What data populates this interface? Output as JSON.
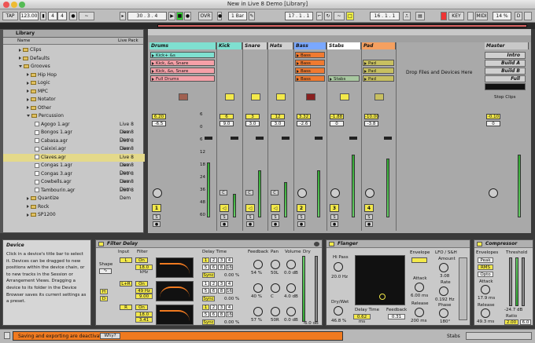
{
  "window": {
    "title": "New in Live 8 Demo  [Library]"
  },
  "toolbar": {
    "tap": "TAP",
    "tempo": "123.00",
    "sig_num": "4",
    "sig_den": "4",
    "pos": "30 .  3 .  4",
    "ovr": "OVR",
    "quant": "1 Bar",
    "loop_start": "17 .  1 .  1",
    "loop_len": "16 .  1 .  1",
    "key": "KEY",
    "midi": "MIDI",
    "cpu": "14 %",
    "d": "D"
  },
  "browser": {
    "title": "Library",
    "col_name": "Name",
    "col_pack": "Live Pack",
    "items": [
      {
        "label": "Clips",
        "type": "folder",
        "level": 0,
        "pack": ""
      },
      {
        "label": "Defaults",
        "type": "folder",
        "level": 0,
        "pack": ""
      },
      {
        "label": "Grooves",
        "type": "folder-open",
        "level": 0,
        "pack": ""
      },
      {
        "label": "Hip Hop",
        "type": "folder",
        "level": 1,
        "pack": ""
      },
      {
        "label": "Logic",
        "type": "folder",
        "level": 1,
        "pack": ""
      },
      {
        "label": "MPC",
        "type": "folder",
        "level": 1,
        "pack": ""
      },
      {
        "label": "Notator",
        "type": "folder",
        "level": 1,
        "pack": ""
      },
      {
        "label": "Other",
        "type": "folder",
        "level": 1,
        "pack": ""
      },
      {
        "label": "Percussion",
        "type": "folder-open",
        "level": 1,
        "pack": ""
      },
      {
        "label": "Agogo 1.agr",
        "type": "file",
        "level": 2,
        "pack": "Live 8 Dem"
      },
      {
        "label": "Bongos 1.agr",
        "type": "file",
        "level": 2,
        "pack": "Live 8 Dem"
      },
      {
        "label": "Cabasa.agr",
        "type": "file",
        "level": 2,
        "pack": "Live 8 Dem"
      },
      {
        "label": "Caixixi.agr",
        "type": "file",
        "level": 2,
        "pack": "Live 8 Dem"
      },
      {
        "label": "Claves.agr",
        "type": "file",
        "level": 2,
        "pack": "Live 8 Dem",
        "selected": true
      },
      {
        "label": "Congas 1.agr",
        "type": "file",
        "level": 2,
        "pack": "Live 8 Dem"
      },
      {
        "label": "Congas 3.agr",
        "type": "file",
        "level": 2,
        "pack": "Live 8 Dem"
      },
      {
        "label": "Cowbells.agr",
        "type": "file",
        "level": 2,
        "pack": "Live 8 Dem"
      },
      {
        "label": "Tambourin.agr",
        "type": "file",
        "level": 2,
        "pack": "Live 8 Dem"
      },
      {
        "label": "Quantize",
        "type": "folder",
        "level": 1,
        "pack": ""
      },
      {
        "label": "Rock",
        "type": "folder",
        "level": 1,
        "pack": ""
      },
      {
        "label": "SP1200",
        "type": "folder",
        "level": 1,
        "pack": ""
      }
    ]
  },
  "session": {
    "tracks": [
      {
        "name": "Drums",
        "color": "#7fe0d0",
        "clips": [
          "Kick+ &s",
          "Kick, &s, Snare",
          "Kick, &s, Snare",
          "Full Drums"
        ],
        "clip_colors": [
          "#7fe0d0",
          "#f5a0a8",
          "#f5a0a8",
          "#f5a0a8"
        ],
        "vol": "6.20",
        "vol2": "-6.5",
        "num": "1"
      },
      {
        "name": "Kick",
        "color": "#7fe0d0",
        "clips": [],
        "clip_colors": [],
        "vol": "6",
        "vol2": "9.0",
        "num": ""
      },
      {
        "name": "Snare",
        "color": "#d0d0d0",
        "clips": [],
        "clip_colors": [],
        "vol": "3",
        "vol2": "3.0",
        "num": ""
      },
      {
        "name": "Hats",
        "color": "#d0d0d0",
        "clips": [],
        "clip_colors": [],
        "vol": "12",
        "vol2": "3.0",
        "num": ""
      },
      {
        "name": "Bass",
        "color": "#7aa8ff",
        "clips": [
          "Bass",
          "Bass",
          "Bass",
          "Bass"
        ],
        "clip_colors": [
          "#f07a30",
          "#f07a30",
          "#f07a30",
          "#f07a30"
        ],
        "vol": "3.32",
        "vol2": "-2.6",
        "num": "2"
      },
      {
        "name": "Stabs",
        "color": "#ffffff",
        "clips": [
          "",
          "",
          "",
          "Stabs"
        ],
        "clip_colors": [
          "",
          "",
          "",
          "#a8c8a0"
        ],
        "vol": "-1.88",
        "vol2": "0",
        "num": "3"
      },
      {
        "name": "Pad",
        "color": "#f5a060",
        "clips": [
          "",
          "Pad",
          "Pad",
          "Pad"
        ],
        "clip_colors": [
          "",
          "#c8c060",
          "#c8c060",
          "#c8c060"
        ],
        "vol": "-10.00",
        "vol2": "-3.8",
        "num": "4"
      }
    ],
    "drop_text": "Drop Files and Devices Here",
    "master": {
      "name": "Master",
      "scenes": [
        "Intro",
        "Build A",
        "Build B",
        "Full",
        ""
      ],
      "stop": "Stop Clips",
      "vol": "-0.10",
      "vol2": "0"
    },
    "db_scale": [
      "6",
      "0",
      "6",
      "12",
      "18",
      "24",
      "36",
      "48",
      "60"
    ],
    "cue_letters": [
      "C",
      "C",
      "C",
      "C",
      "C",
      "C",
      "C"
    ]
  },
  "info": {
    "title": "Device",
    "text": "Click in a device's title bar to select it. Devices can be dragged to new positions within the device chain, or to new tracks in the Session or Arrangement Views. Dragging a device to its folder in the Device Browser saves its current settings as a preset."
  },
  "filter_delay": {
    "title": "Filter Delay",
    "input": "Input",
    "filter": "Filter",
    "delay_time": "Delay Time",
    "feedback": "Feedback",
    "pan": "Pan",
    "volume": "Volume",
    "dry": "Dry",
    "shape": "Shape",
    "rows": [
      {
        "ch": "L",
        "on": "On",
        "freq": "18.0 kHz",
        "sync": "Sync",
        "pct": "0.00 %",
        "fb": "54 %",
        "pan": "50L",
        "vol": "0.0 dB",
        "dry": "0.0 dB"
      },
      {
        "ch": "L+R",
        "on": "On",
        "freq": "49 Hz",
        "sync": "Sync",
        "pct": "0.00 %",
        "fb": "40 %",
        "pan": "C",
        "vol": "4.0 dB",
        "dry": "0.0 dB"
      },
      {
        "ch": "R",
        "on": "On",
        "freq": "18.0 kHz",
        "sync": "Sync",
        "pct": "0.00 %",
        "fb": "57 %",
        "pan": "50R",
        "vol": "0.0 dB",
        "dry": "-6.0 dB"
      }
    ],
    "q1": "9.00",
    "q2": "3.41",
    "delay_grid": [
      "1",
      "2",
      "3",
      "4",
      "5",
      "6",
      "8",
      "16"
    ]
  },
  "flanger": {
    "title": "Flanger",
    "hi_pass": "Hi Pass",
    "hi_pass_val": "20.0 Hz",
    "drywet": "Dry/Wet",
    "drywet_val": "46.8 %",
    "delay_time": "Delay Time",
    "delay_time_val": "0.62 ms",
    "feedback": "Feedback",
    "feedback_val": "0.31",
    "envelope": "Envelope",
    "attack": "Attack",
    "attack_val": "6.00 ms",
    "release": "Release",
    "release_val": "200 ms",
    "lfo": "LFO / S&H",
    "amount": "Amount",
    "amount_val": "3.08",
    "rate": "Rate",
    "rate_val": "0.192 Hz",
    "phase": "Phase",
    "phase_val": "180°"
  },
  "compressor": {
    "title": "Compressor",
    "envelopes": "Envelopes",
    "threshold": "Threshold",
    "peak": "Peak",
    "rms": "RMS",
    "opto": "Opto",
    "attack": "Attack",
    "attack_val": "17.9 ms",
    "release": "Release",
    "release_val": "49.3 ms",
    "threshold_val": "-24.7 dB",
    "ratio": "Ratio",
    "ratio_val": "2.00",
    "knee": "6.0"
  },
  "status": {
    "message": "Saving and exporting are deactivated.",
    "why": "Why?",
    "stabs": "Stabs"
  }
}
